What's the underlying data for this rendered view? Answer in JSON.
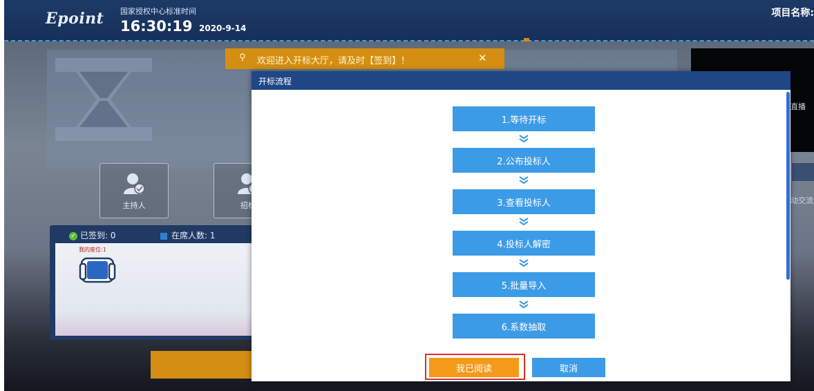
{
  "header": {
    "logo": "Epoint",
    "time_caption": "国家授权中心标准时间",
    "time": "16:30:19",
    "date": "2020-9-14",
    "project_label": "项目名称:"
  },
  "welcome": {
    "text": "欢迎进入开标大厅，请及时【签到】！",
    "close": "✕"
  },
  "roles": [
    {
      "label": "主持人"
    },
    {
      "label": "招标"
    }
  ],
  "seat_panel": {
    "signed_label": "已签到: 0",
    "online_label": "在席人数: 1",
    "my_seat": "我的座位:1"
  },
  "right_side": {
    "text1": "直播",
    "text2": "动交流"
  },
  "modal": {
    "title": "开标流程",
    "steps": [
      {
        "label": "1.等待开标"
      },
      {
        "label": "2.公布投标人"
      },
      {
        "label": "3.查看投标人"
      },
      {
        "label": "4.投标人解密"
      },
      {
        "label": "5.批量导入"
      },
      {
        "label": "6.系数抽取"
      }
    ],
    "confirm_label": "我已阅读",
    "cancel_label": "取消"
  },
  "colors": {
    "header_bg": "#1d3a66",
    "modal_title_bg": "#1f4786",
    "step_bg": "#3c9be6",
    "confirm_bg": "#f39a18",
    "highlight_border": "#e02b2b",
    "welcome_bg": "#d48f12"
  },
  "icons": [
    "location-pin-icon",
    "close-icon",
    "person-icon",
    "check-icon",
    "seat-icon",
    "chevron-double-down-icon"
  ]
}
